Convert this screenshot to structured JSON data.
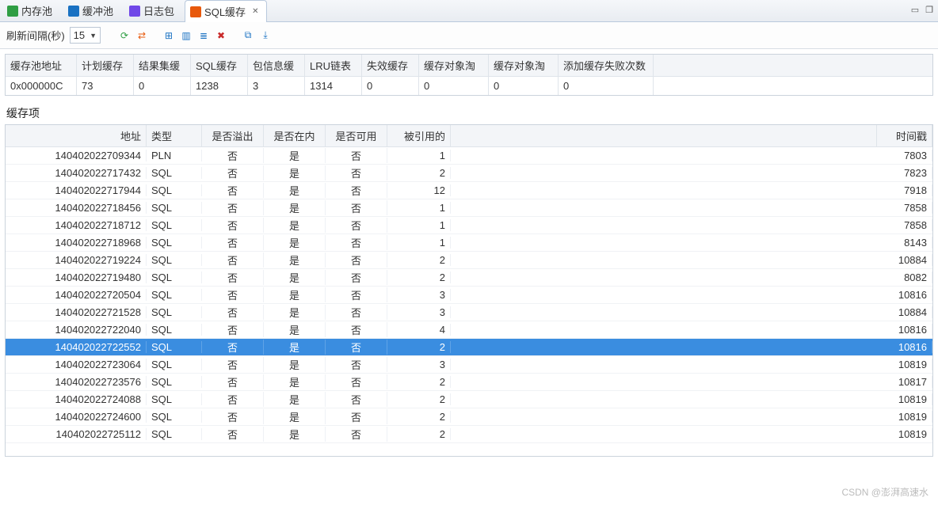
{
  "tabs": [
    {
      "label": "内存池",
      "icon": "memory-icon",
      "icon_color": "#2f9e44"
    },
    {
      "label": "缓冲池",
      "icon": "buffer-icon",
      "icon_color": "#1971c2"
    },
    {
      "label": "日志包",
      "icon": "log-icon",
      "icon_color": "#7048e8"
    },
    {
      "label": "SQL缓存",
      "icon": "sql-icon",
      "icon_color": "#e8590c",
      "active": true
    }
  ],
  "toolbar": {
    "refresh_label": "刷新间隔(秒)",
    "refresh_value": "15"
  },
  "summary": {
    "headers": [
      "缓存池地址",
      "计划缓存",
      "结果集缓",
      "SQL缓存",
      "包信息缓",
      "LRU链表",
      "失效缓存",
      "缓存对象淘",
      "缓存对象淘",
      "添加缓存失败次数"
    ],
    "row": [
      "0x000000C",
      "73",
      "0",
      "1238",
      "3",
      "1314",
      "0",
      "0",
      "0",
      "0"
    ]
  },
  "section_title": "缓存项",
  "grid": {
    "headers": {
      "addr": "地址",
      "type": "类型",
      "overflow": "是否溢出",
      "inmem": "是否在内",
      "avail": "是否可用",
      "refd": "被引用的",
      "ts": "时间戳"
    },
    "rows": [
      {
        "addr": "140402022709344",
        "type": "PLN",
        "ovf": "否",
        "inmem": "是",
        "avail": "否",
        "ref": "1",
        "ts": "7803",
        "sel": false
      },
      {
        "addr": "140402022717432",
        "type": "SQL",
        "ovf": "否",
        "inmem": "是",
        "avail": "否",
        "ref": "2",
        "ts": "7823",
        "sel": false
      },
      {
        "addr": "140402022717944",
        "type": "SQL",
        "ovf": "否",
        "inmem": "是",
        "avail": "否",
        "ref": "12",
        "ts": "7918",
        "sel": false
      },
      {
        "addr": "140402022718456",
        "type": "SQL",
        "ovf": "否",
        "inmem": "是",
        "avail": "否",
        "ref": "1",
        "ts": "7858",
        "sel": false
      },
      {
        "addr": "140402022718712",
        "type": "SQL",
        "ovf": "否",
        "inmem": "是",
        "avail": "否",
        "ref": "1",
        "ts": "7858",
        "sel": false
      },
      {
        "addr": "140402022718968",
        "type": "SQL",
        "ovf": "否",
        "inmem": "是",
        "avail": "否",
        "ref": "1",
        "ts": "8143",
        "sel": false
      },
      {
        "addr": "140402022719224",
        "type": "SQL",
        "ovf": "否",
        "inmem": "是",
        "avail": "否",
        "ref": "2",
        "ts": "10884",
        "sel": false
      },
      {
        "addr": "140402022719480",
        "type": "SQL",
        "ovf": "否",
        "inmem": "是",
        "avail": "否",
        "ref": "2",
        "ts": "8082",
        "sel": false
      },
      {
        "addr": "140402022720504",
        "type": "SQL",
        "ovf": "否",
        "inmem": "是",
        "avail": "否",
        "ref": "3",
        "ts": "10816",
        "sel": false
      },
      {
        "addr": "140402022721528",
        "type": "SQL",
        "ovf": "否",
        "inmem": "是",
        "avail": "否",
        "ref": "3",
        "ts": "10884",
        "sel": false
      },
      {
        "addr": "140402022722040",
        "type": "SQL",
        "ovf": "否",
        "inmem": "是",
        "avail": "否",
        "ref": "4",
        "ts": "10816",
        "sel": false
      },
      {
        "addr": "140402022722552",
        "type": "SQL",
        "ovf": "否",
        "inmem": "是",
        "avail": "否",
        "ref": "2",
        "ts": "10816",
        "sel": true
      },
      {
        "addr": "140402022723064",
        "type": "SQL",
        "ovf": "否",
        "inmem": "是",
        "avail": "否",
        "ref": "3",
        "ts": "10819",
        "sel": false
      },
      {
        "addr": "140402022723576",
        "type": "SQL",
        "ovf": "否",
        "inmem": "是",
        "avail": "否",
        "ref": "2",
        "ts": "10817",
        "sel": false
      },
      {
        "addr": "140402022724088",
        "type": "SQL",
        "ovf": "否",
        "inmem": "是",
        "avail": "否",
        "ref": "2",
        "ts": "10819",
        "sel": false
      },
      {
        "addr": "140402022724600",
        "type": "SQL",
        "ovf": "否",
        "inmem": "是",
        "avail": "否",
        "ref": "2",
        "ts": "10819",
        "sel": false
      },
      {
        "addr": "140402022725112",
        "type": "SQL",
        "ovf": "否",
        "inmem": "是",
        "avail": "否",
        "ref": "2",
        "ts": "10819",
        "sel": false
      }
    ]
  },
  "watermark": "CSDN @澎湃高速水"
}
